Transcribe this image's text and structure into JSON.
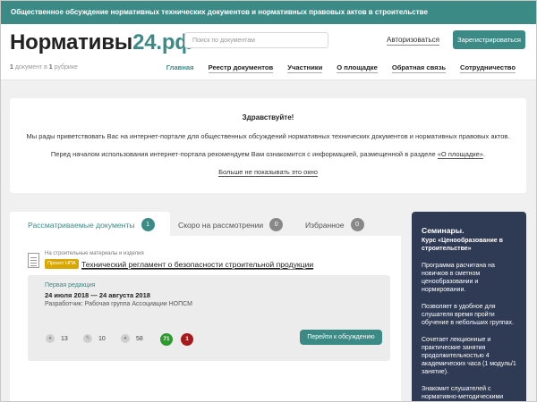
{
  "topbar": {
    "text": "Общественное обсуждение нормативных технических документов и нормативных правовых актов в строительстве"
  },
  "header": {
    "logo_main": "Нормативы",
    "logo_accent": "24.рф",
    "search_placeholder": "Поиск по документам",
    "login_label": "Авторизоваться",
    "register_label": "Зарегистрироваться",
    "doc_count_num1": "1",
    "doc_count_mid": " документ в ",
    "doc_count_num2": "1",
    "doc_count_end": " рубрике",
    "nav": [
      {
        "label": "Главная",
        "active": true
      },
      {
        "label": "Реестр документов"
      },
      {
        "label": "Участники"
      },
      {
        "label": "О площадке"
      },
      {
        "label": "Обратная связь"
      },
      {
        "label": "Сотрудничество"
      }
    ]
  },
  "welcome": {
    "title": "Здравствуйте!",
    "line1": "Мы рады приветствовать Вас на интернет-портале для общественных обсуждений нормативных технических документов и нормативных правовых актов.",
    "line2_text": "Перед началом использования интернет-портала рекомендуем Вам ознакомится с информацией, размещенной в разделе ",
    "line2_link": "«О площадке»",
    "line2_end": ".",
    "hide_label": "Больше не показывать это окно"
  },
  "tabs": [
    {
      "label": "Рассматриваемые документы",
      "count": "1"
    },
    {
      "label": "Скоро на рассмотрении",
      "count": "0"
    },
    {
      "label": "Избранное",
      "count": "0"
    }
  ],
  "document": {
    "category": "На строительные материалы и изделия",
    "badge": "Проект НПА",
    "title": "Технический регламент о безопасности строительной продукции",
    "edition": {
      "label": "Первая редакция",
      "dates": "24 июля 2018 — 24 августа 2018",
      "developer": "Разработчик: Рабочая группа Ассоциации НОПСМ"
    },
    "stats": {
      "participants": "13",
      "comments": "10",
      "views": "58",
      "green": "71",
      "red": "1"
    },
    "discuss_label": "Перейти к обсуждению"
  },
  "sidebar": {
    "title": "Семинары.",
    "subtitle": "Курс «Ценообразование в строительстве»",
    "p1": "Программа расчитана на новичков в сметном ценообразовании и нормировании.",
    "p2": "Позволяет в удобное для слушателя время пройти обучение в небольших группах.",
    "p3": "Сочетает лекционные и практические занятия продолжительностью 4 академических часа (1 модуль/1 занятие).",
    "p4": "Знакомит слушателей с нормативно-методическими"
  },
  "colors": {
    "accent": "#3b8a86",
    "sidebar_bg": "#2f3b54",
    "badge_npa": "#d8a800",
    "green": "#2e9a2e",
    "red": "#a8191b"
  }
}
